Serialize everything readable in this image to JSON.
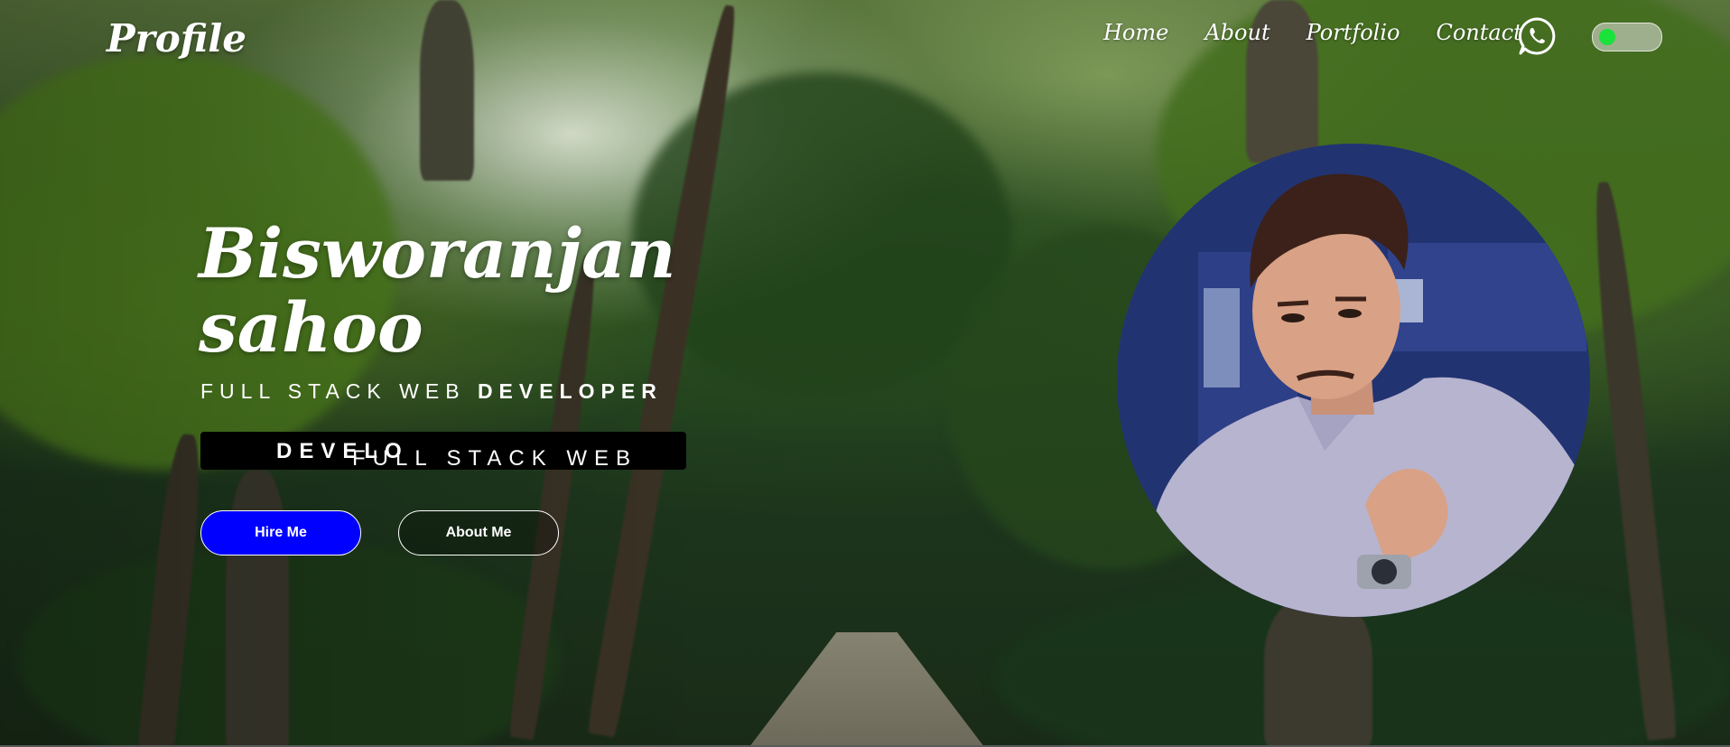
{
  "nav": {
    "logo": "Profile",
    "links": [
      "Home",
      "About",
      "Portfolio",
      "Contact"
    ],
    "whatsapp_icon": "whatsapp-icon",
    "theme_toggle": {
      "state": "on",
      "knob_color": "#19e23a"
    }
  },
  "hero": {
    "name_line1": "Bisworanjan",
    "name_line2": "sahoo",
    "subtitle_light": "FULL STACK WEB ",
    "subtitle_bold": "DEVELOPER",
    "marquee_light": "FULL STACK WEB ",
    "marquee_bold": "DEVELO",
    "hire_button": "Hire Me",
    "about_button": "About Me"
  },
  "colors": {
    "hire_button": "#0000ff",
    "marquee_bg": "#000000",
    "text": "#ffffff"
  }
}
